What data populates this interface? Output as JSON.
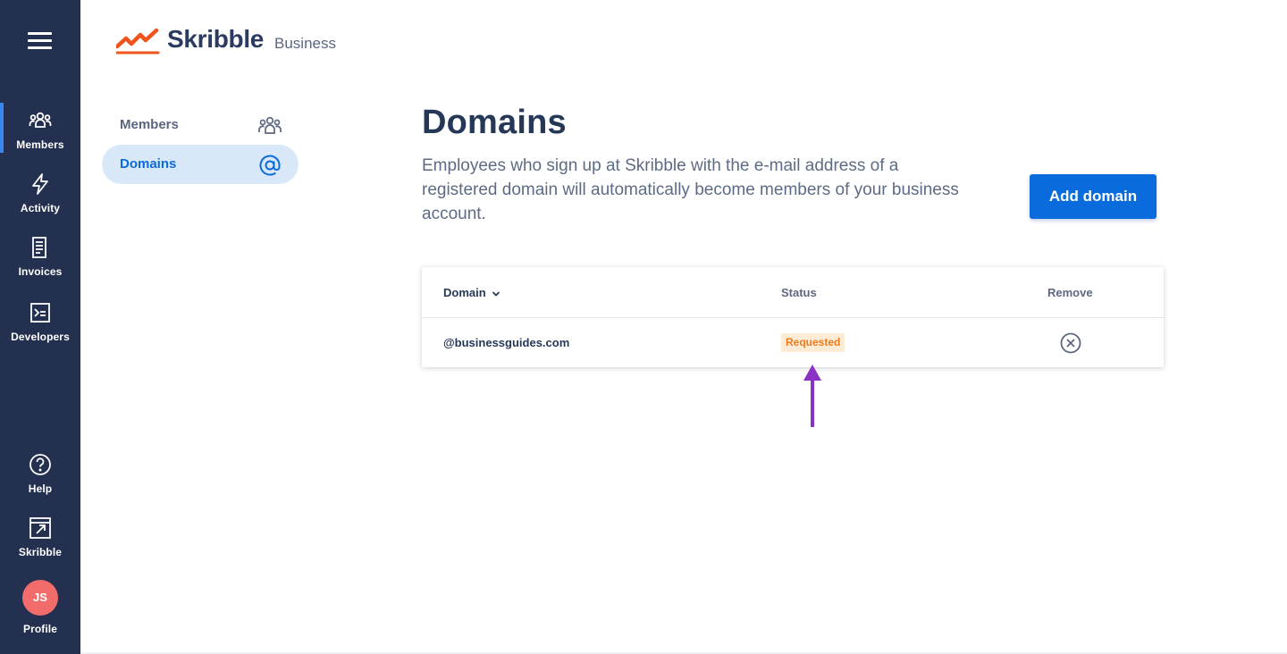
{
  "sidebar": {
    "items": [
      {
        "label": "Members"
      },
      {
        "label": "Activity"
      },
      {
        "label": "Invoices"
      },
      {
        "label": "Developers"
      }
    ],
    "bottom_items": [
      {
        "label": "Help"
      },
      {
        "label": "Skribble"
      },
      {
        "label": "Profile",
        "avatar_initials": "JS"
      }
    ],
    "active": "Members"
  },
  "brand": {
    "name": "Skribble",
    "suffix": "Business"
  },
  "subnav": {
    "items": [
      {
        "label": "Members",
        "icon": "members-icon"
      },
      {
        "label": "Domains",
        "icon": "at-icon"
      }
    ],
    "active": "Domains"
  },
  "main": {
    "title": "Domains",
    "description": "Employees who sign up at Skribble with the e-mail address of a registered domain will automatically become members of your business account.",
    "add_button_label": "Add domain"
  },
  "table": {
    "columns": [
      "Domain",
      "Status",
      "Remove"
    ],
    "rows": [
      {
        "domain": "@businessguides.com",
        "status": "Requested"
      }
    ]
  },
  "colors": {
    "rail": "#23304f",
    "accent": "#0a6bdc",
    "status_requested_bg": "#fdebd5",
    "status_requested_text": "#ef7b1e",
    "annotation_arrow": "#8a32c4",
    "avatar": "#f26c6c"
  }
}
